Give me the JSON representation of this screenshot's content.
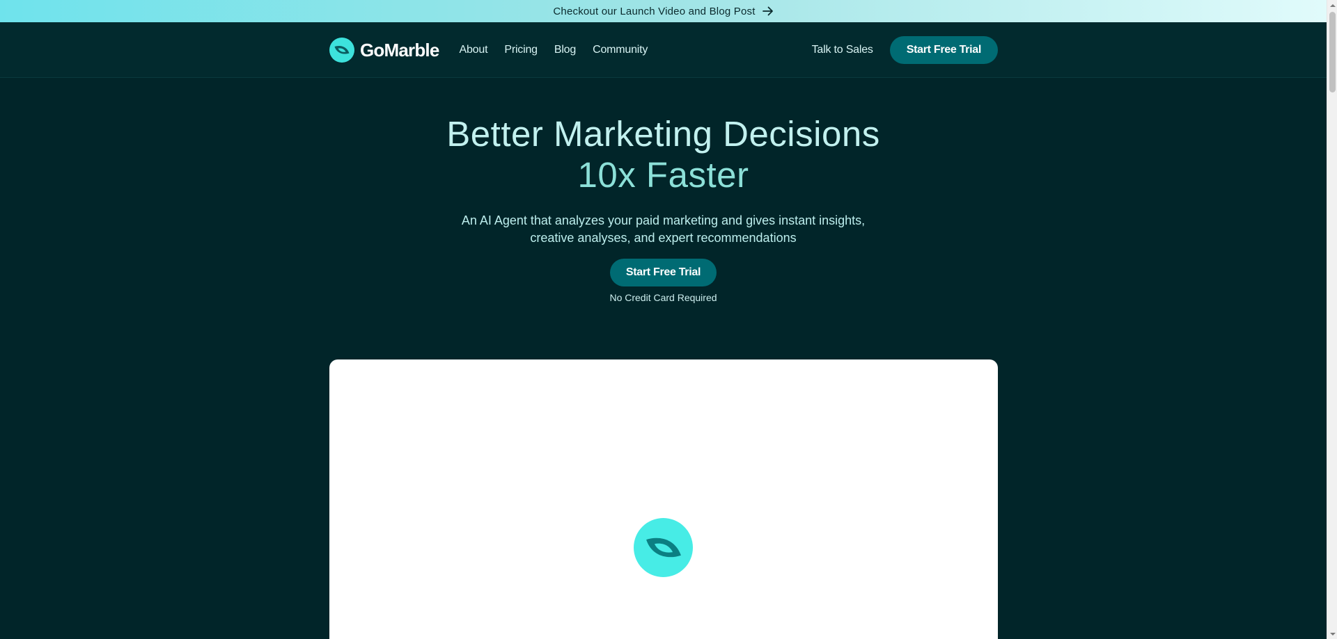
{
  "announcement": {
    "text": "Checkout our Launch Video and Blog Post",
    "arrow_icon": "arrow-right-icon"
  },
  "header": {
    "logo_text": "GoMarble",
    "nav": [
      {
        "label": "About"
      },
      {
        "label": "Pricing"
      },
      {
        "label": "Blog"
      },
      {
        "label": "Community"
      }
    ],
    "talk_to_sales": "Talk to Sales",
    "cta_label": "Start Free Trial"
  },
  "hero": {
    "title_line1": "Better Marketing Decisions",
    "title_line2": "10x Faster",
    "subtitle": "An AI Agent that analyzes your paid marketing and gives instant insights, creative analyses, and expert recommendations",
    "cta_label": "Start Free Trial",
    "note": "No Credit Card Required"
  },
  "colors": {
    "background": "#012529",
    "header": "#022a2e",
    "accent_button": "#006b73",
    "logo_teal": "#3de2dc",
    "title": "#c2f1ef",
    "title_accent": "#8ce0d8"
  }
}
